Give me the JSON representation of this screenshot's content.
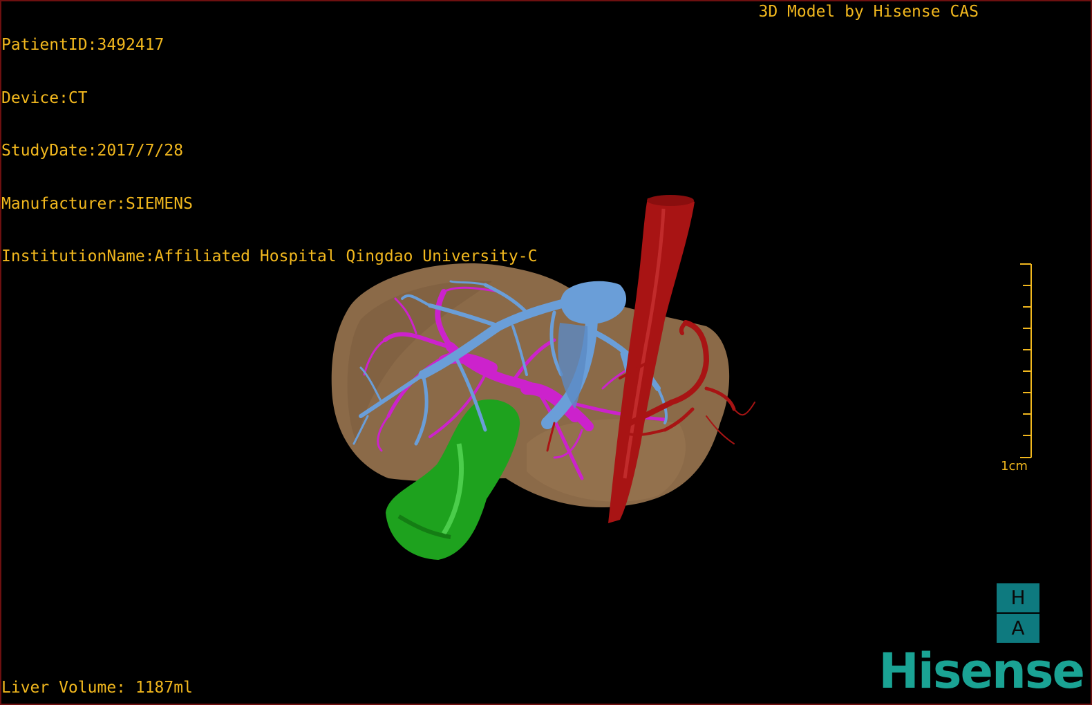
{
  "header": {
    "patient_id": "PatientID:3492417",
    "device": "Device:CT",
    "study_date": "StudyDate:2017/7/28",
    "manufacturer": "Manufacturer:SIEMENS",
    "institution": "InstitutionName:Affiliated Hospital Qingdao University-C"
  },
  "brand_caption": "3D Model by Hisense CAS",
  "scale_bar": {
    "label": "1cm"
  },
  "orientation": {
    "top": "H",
    "bottom": "A"
  },
  "footer": {
    "liver_volume": "Liver Volume: 1187ml"
  },
  "logo": {
    "text": "Hisense"
  },
  "colors": {
    "text": "#f2b81e",
    "liver": "#8b6a48",
    "portal_vein": "#6a9ed8",
    "hepatic_vein": "#cc22cc",
    "artery": "#a81414",
    "gallbladder": "#1ea21e",
    "logo": "#1aa394",
    "orientation_cube": "#0e7a7f"
  }
}
